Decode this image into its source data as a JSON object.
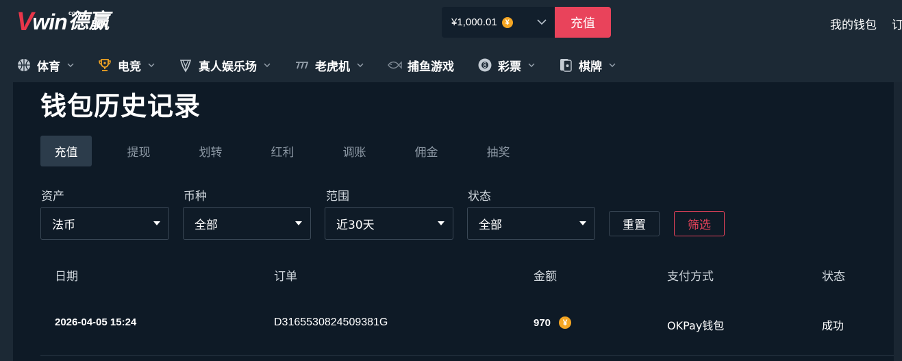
{
  "header": {
    "logo": {
      "v": "V",
      "win": "win",
      "com": "com",
      "cn": "德赢"
    },
    "balance": {
      "amount": "¥1,000.01",
      "coin_symbol": "¥"
    },
    "deposit_label": "充值",
    "wallet_label": "我的钱包",
    "order_label": "订"
  },
  "nav": {
    "items": [
      {
        "label": "体育",
        "icon": "basketball-icon",
        "has_dropdown": true
      },
      {
        "label": "电竞",
        "icon": "trophy-icon",
        "has_dropdown": true
      },
      {
        "label": "真人娱乐场",
        "icon": "diamond-icon",
        "has_dropdown": true
      },
      {
        "label": "老虎机",
        "icon": "slot-777-icon",
        "has_dropdown": true
      },
      {
        "label": "捕鱼游戏",
        "icon": "fish-icon",
        "has_dropdown": false
      },
      {
        "label": "彩票",
        "icon": "lottery-ball-icon",
        "has_dropdown": true
      },
      {
        "label": "棋牌",
        "icon": "cards-icon",
        "has_dropdown": true
      }
    ]
  },
  "page": {
    "title": "钱包历史记录"
  },
  "tabs": [
    {
      "label": "充值",
      "active": true
    },
    {
      "label": "提现",
      "active": false
    },
    {
      "label": "划转",
      "active": false
    },
    {
      "label": "红利",
      "active": false
    },
    {
      "label": "调账",
      "active": false
    },
    {
      "label": "佣金",
      "active": false
    },
    {
      "label": "抽奖",
      "active": false
    }
  ],
  "filters": {
    "asset": {
      "label": "资产",
      "value": "法币"
    },
    "currency": {
      "label": "币种",
      "value": "全部"
    },
    "range": {
      "label": "范围",
      "value": "近30天"
    },
    "status": {
      "label": "状态",
      "value": "全部"
    },
    "reset_label": "重置",
    "filter_label": "筛选"
  },
  "table": {
    "headers": {
      "date": "日期",
      "order": "订单",
      "amount": "金额",
      "payment": "支付方式",
      "status": "状态"
    },
    "rows": [
      {
        "date": "2026-04-05 15:24",
        "order": "D3165530824509381G",
        "amount": "970",
        "coin_symbol": "¥",
        "payment": "OKPay钱包",
        "status": "成功"
      }
    ]
  },
  "colors": {
    "brand_red": "#e9435b",
    "coin_gold": "#f5a623",
    "header_bg": "#1c2935",
    "page_bg": "#0e1a26"
  }
}
